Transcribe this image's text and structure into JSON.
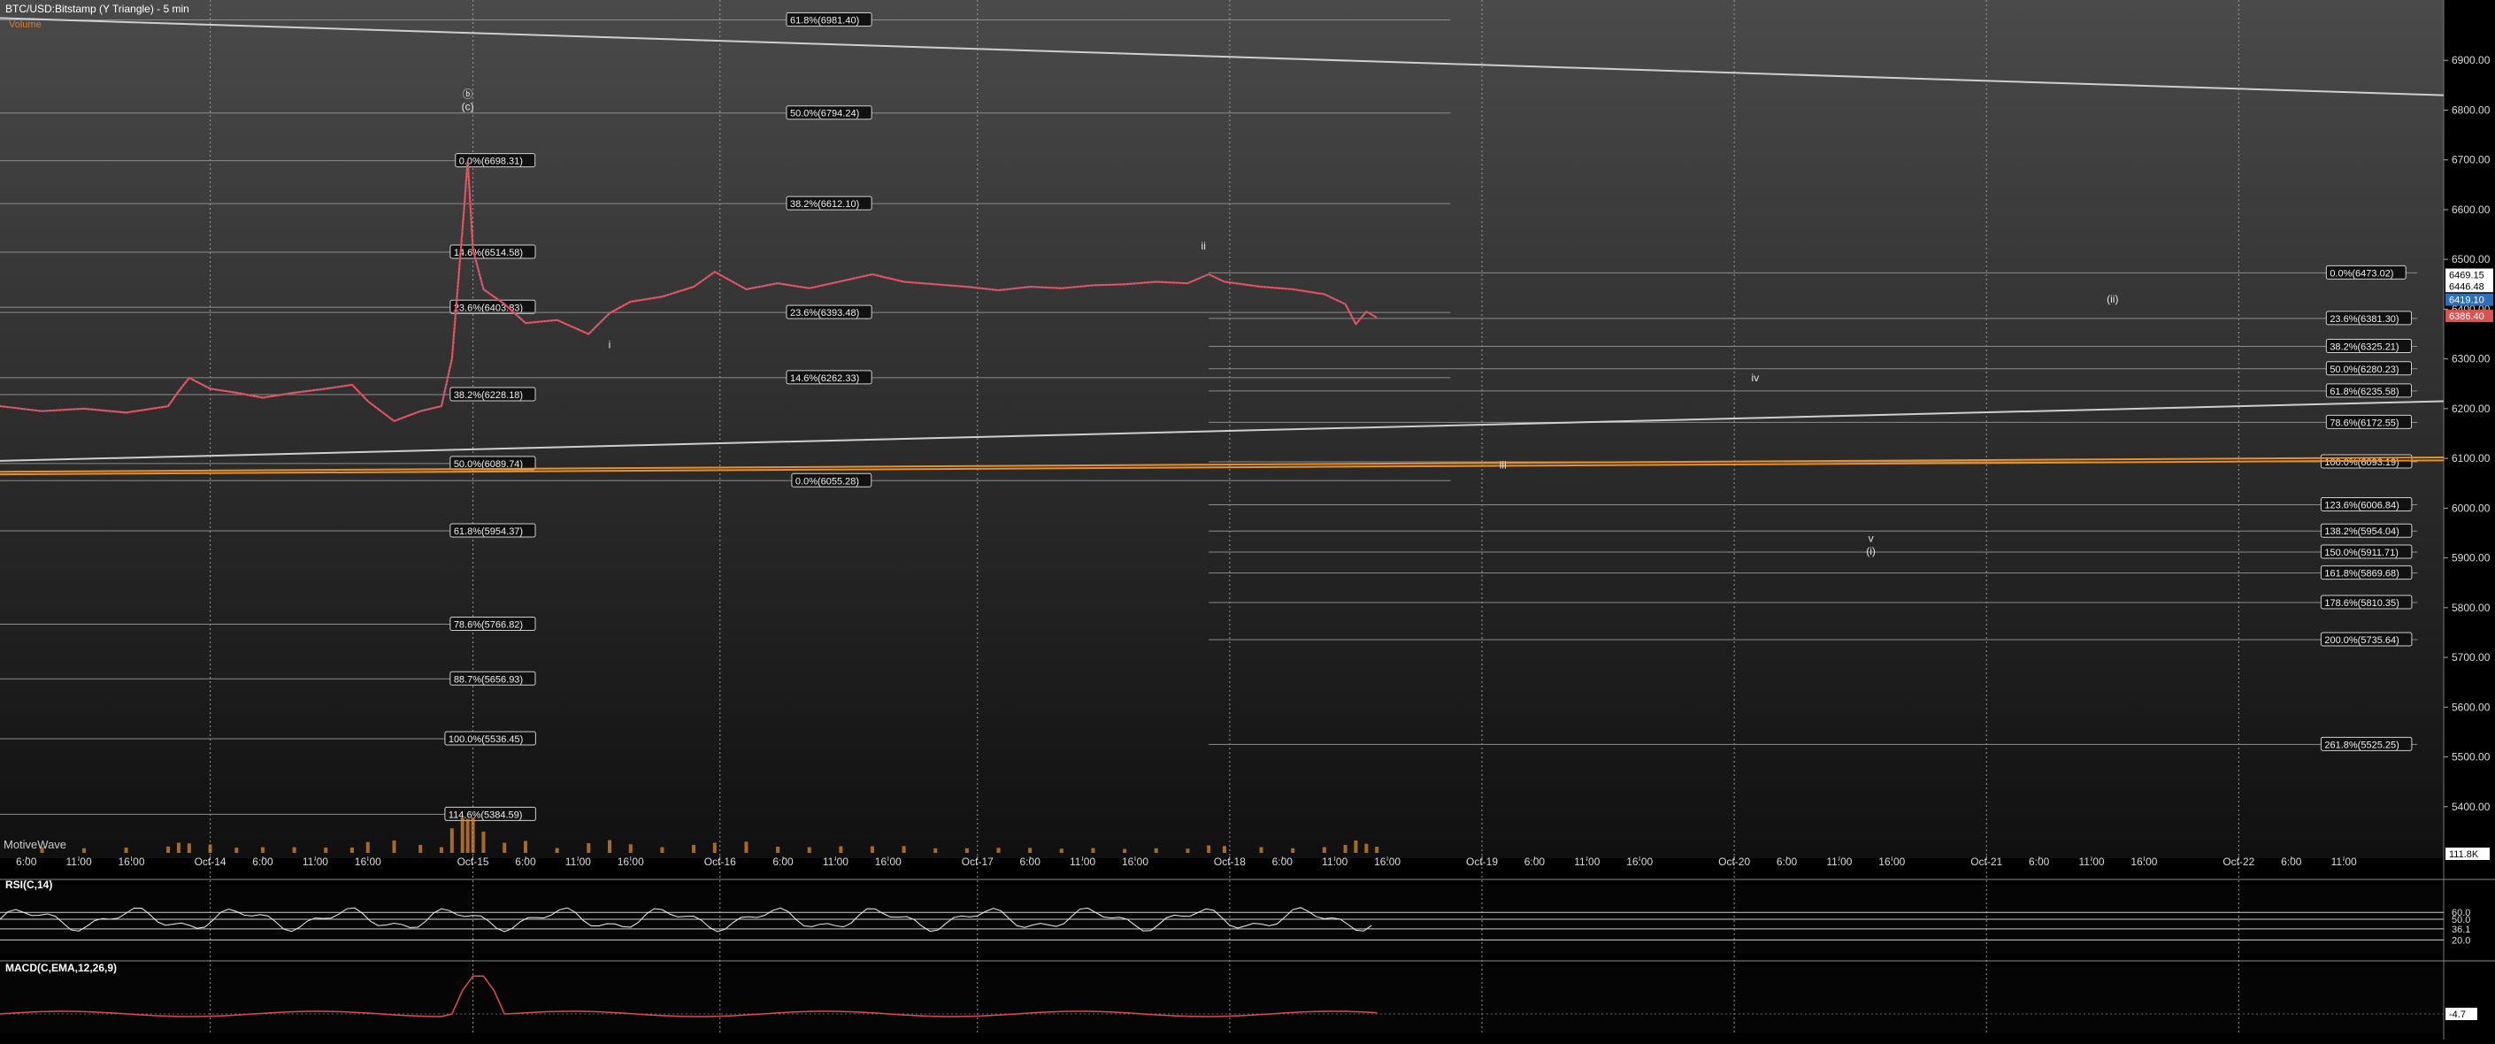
{
  "header": {
    "title": "BTC/USD:Bitstamp (Y Triangle) - 5 min",
    "subtitle": "Volume",
    "watermark": "MotiveWave"
  },
  "chart_data": {
    "type": "line",
    "price_axis": {
      "min": 5300,
      "max": 7000,
      "ticks": [
        6900,
        6800,
        6700,
        6600,
        6500,
        6400,
        6300,
        6200,
        6100,
        6000,
        5900,
        5800,
        5700,
        5600,
        5500,
        5400
      ]
    },
    "time_labels": [
      {
        "t": 0.5,
        "label": "6:00"
      },
      {
        "t": 1.5,
        "label": "11:00"
      },
      {
        "t": 2.5,
        "label": "16:00"
      },
      {
        "t": 4.0,
        "label": "Oct-14"
      },
      {
        "t": 5.0,
        "label": "6:00"
      },
      {
        "t": 6.0,
        "label": "11:00"
      },
      {
        "t": 7.0,
        "label": "16:00"
      },
      {
        "t": 9.0,
        "label": "Oct-15"
      },
      {
        "t": 10.0,
        "label": "6:00"
      },
      {
        "t": 11.0,
        "label": "11:00"
      },
      {
        "t": 12.0,
        "label": "16:00"
      },
      {
        "t": 13.7,
        "label": "Oct-16"
      },
      {
        "t": 14.9,
        "label": "6:00"
      },
      {
        "t": 15.9,
        "label": "11:00"
      },
      {
        "t": 16.9,
        "label": "16:00"
      },
      {
        "t": 18.6,
        "label": "Oct-17"
      },
      {
        "t": 19.6,
        "label": "6:00"
      },
      {
        "t": 20.6,
        "label": "11:00"
      },
      {
        "t": 21.6,
        "label": "16:00"
      },
      {
        "t": 23.4,
        "label": "Oct-18"
      },
      {
        "t": 24.4,
        "label": "6:00"
      },
      {
        "t": 25.4,
        "label": "11:00"
      },
      {
        "t": 26.4,
        "label": "16:00"
      },
      {
        "t": 28.2,
        "label": "Oct-19"
      },
      {
        "t": 29.2,
        "label": "6:00"
      },
      {
        "t": 30.2,
        "label": "11:00"
      },
      {
        "t": 31.2,
        "label": "16:00"
      },
      {
        "t": 33.0,
        "label": "Oct-20"
      },
      {
        "t": 34.0,
        "label": "6:00"
      },
      {
        "t": 35.0,
        "label": "11:00"
      },
      {
        "t": 36.0,
        "label": "16:00"
      },
      {
        "t": 37.8,
        "label": "Oct-21"
      },
      {
        "t": 38.8,
        "label": "6:00"
      },
      {
        "t": 39.8,
        "label": "11:00"
      },
      {
        "t": 40.8,
        "label": "16:00"
      },
      {
        "t": 42.6,
        "label": "Oct-22"
      },
      {
        "t": 43.6,
        "label": "6:00"
      },
      {
        "t": 44.6,
        "label": "11:00"
      }
    ],
    "price_series": [
      {
        "t": 0,
        "p": 6205
      },
      {
        "t": 0.8,
        "p": 6195
      },
      {
        "t": 1.6,
        "p": 6200
      },
      {
        "t": 2.4,
        "p": 6192
      },
      {
        "t": 3.2,
        "p": 6205
      },
      {
        "t": 3.4,
        "p": 6235
      },
      {
        "t": 3.6,
        "p": 6262
      },
      {
        "t": 4.0,
        "p": 6240
      },
      {
        "t": 4.5,
        "p": 6232
      },
      {
        "t": 5.0,
        "p": 6222
      },
      {
        "t": 5.6,
        "p": 6232
      },
      {
        "t": 6.2,
        "p": 6240
      },
      {
        "t": 6.7,
        "p": 6248
      },
      {
        "t": 7.0,
        "p": 6215
      },
      {
        "t": 7.5,
        "p": 6175
      },
      {
        "t": 8.0,
        "p": 6195
      },
      {
        "t": 8.4,
        "p": 6205
      },
      {
        "t": 8.6,
        "p": 6300
      },
      {
        "t": 8.8,
        "p": 6560
      },
      {
        "t": 8.9,
        "p": 6698
      },
      {
        "t": 9.0,
        "p": 6520
      },
      {
        "t": 9.2,
        "p": 6440
      },
      {
        "t": 9.6,
        "p": 6410
      },
      {
        "t": 10.0,
        "p": 6372
      },
      {
        "t": 10.6,
        "p": 6378
      },
      {
        "t": 11.2,
        "p": 6350
      },
      {
        "t": 11.6,
        "p": 6392
      },
      {
        "t": 12.0,
        "p": 6415
      },
      {
        "t": 12.6,
        "p": 6425
      },
      {
        "t": 13.2,
        "p": 6445
      },
      {
        "t": 13.6,
        "p": 6475
      },
      {
        "t": 14.2,
        "p": 6440
      },
      {
        "t": 14.8,
        "p": 6452
      },
      {
        "t": 15.4,
        "p": 6442
      },
      {
        "t": 16.0,
        "p": 6456
      },
      {
        "t": 16.6,
        "p": 6470
      },
      {
        "t": 17.2,
        "p": 6455
      },
      {
        "t": 17.8,
        "p": 6450
      },
      {
        "t": 18.4,
        "p": 6445
      },
      {
        "t": 19.0,
        "p": 6438
      },
      {
        "t": 19.6,
        "p": 6445
      },
      {
        "t": 20.2,
        "p": 6442
      },
      {
        "t": 20.8,
        "p": 6448
      },
      {
        "t": 21.4,
        "p": 6450
      },
      {
        "t": 22.0,
        "p": 6455
      },
      {
        "t": 22.6,
        "p": 6452
      },
      {
        "t": 23.0,
        "p": 6470
      },
      {
        "t": 23.3,
        "p": 6455
      },
      {
        "t": 24.0,
        "p": 6445
      },
      {
        "t": 24.6,
        "p": 6440
      },
      {
        "t": 25.2,
        "p": 6430
      },
      {
        "t": 25.6,
        "p": 6410
      },
      {
        "t": 25.8,
        "p": 6370
      },
      {
        "t": 26.0,
        "p": 6395
      },
      {
        "t": 26.2,
        "p": 6383
      }
    ],
    "fib_levels": [
      {
        "price": 6981.4,
        "label": "61.8%(6981.40)",
        "t0": 0,
        "t1": 27.6,
        "tl": 15.0
      },
      {
        "price": 6794.24,
        "label": "50.0%(6794.24)",
        "t0": 0,
        "t1": 27.6,
        "tl": 15.0
      },
      {
        "price": 6698.31,
        "label": "0.0%(6698.31)",
        "t0": 0,
        "t1": 9.6,
        "tl": 8.7
      },
      {
        "price": 6612.1,
        "label": "38.2%(6612.10)",
        "t0": 0,
        "t1": 27.6,
        "tl": 15.0
      },
      {
        "price": 6514.58,
        "label": "14.6%(6514.58)",
        "t0": 0,
        "t1": 9.6,
        "tl": 8.6
      },
      {
        "price": 6403.83,
        "label": "23.6%(6403.83)",
        "t0": 0,
        "t1": 9.6,
        "tl": 8.6
      },
      {
        "price": 6393.48,
        "label": "23.6%(6393.48)",
        "t0": 0,
        "t1": 27.6,
        "tl": 15.0
      },
      {
        "price": 6262.33,
        "label": "14.6%(6262.33)",
        "t0": 0,
        "t1": 27.6,
        "tl": 15.0
      },
      {
        "price": 6228.18,
        "label": "38.2%(6228.18)",
        "t0": 0,
        "t1": 9.6,
        "tl": 8.6
      },
      {
        "price": 6089.74,
        "label": "50.0%(6089.74)",
        "t0": 0,
        "t1": 9.6,
        "tl": 8.6
      },
      {
        "price": 6055.28,
        "label": "0.0%(6055.28)",
        "t0": 0,
        "t1": 27.6,
        "tl": 15.1
      },
      {
        "price": 5954.37,
        "label": "61.8%(5954.37)",
        "t0": 0,
        "t1": 9.6,
        "tl": 8.6
      },
      {
        "price": 5766.82,
        "label": "78.6%(5766.82)",
        "t0": 0,
        "t1": 9.6,
        "tl": 8.6
      },
      {
        "price": 5656.93,
        "label": "88.7%(5656.93)",
        "t0": 0,
        "t1": 9.6,
        "tl": 8.6
      },
      {
        "price": 5536.45,
        "label": "100.0%(5536.45)",
        "t0": 0,
        "t1": 9.6,
        "tl": 8.5
      },
      {
        "price": 5384.59,
        "label": "114.6%(5384.59)",
        "t0": 0,
        "t1": 9.6,
        "tl": 8.5
      },
      {
        "price": 6473.02,
        "label": "0.0%(6473.02)",
        "t0": 23.0,
        "t1": 46.0,
        "tl": 44.3
      },
      {
        "price": 6381.3,
        "label": "23.6%(6381.30)",
        "t0": 23.0,
        "t1": 46.0,
        "tl": 44.3
      },
      {
        "price": 6325.21,
        "label": "38.2%(6325.21)",
        "t0": 23.0,
        "t1": 46.0,
        "tl": 44.3
      },
      {
        "price": 6280.23,
        "label": "50.0%(6280.23)",
        "t0": 23.0,
        "t1": 46.0,
        "tl": 44.3
      },
      {
        "price": 6235.58,
        "label": "61.8%(6235.58)",
        "t0": 23.0,
        "t1": 46.0,
        "tl": 44.3
      },
      {
        "price": 6172.55,
        "label": "78.6%(6172.55)",
        "t0": 23.0,
        "t1": 46.0,
        "tl": 44.3
      },
      {
        "price": 6093.19,
        "label": "100.0%(6093.19)",
        "t0": 23.0,
        "t1": 46.0,
        "tl": 44.2
      },
      {
        "price": 6006.84,
        "label": "123.6%(6006.84)",
        "t0": 23.0,
        "t1": 46.0,
        "tl": 44.2
      },
      {
        "price": 5954.04,
        "label": "138.2%(5954.04)",
        "t0": 23.0,
        "t1": 46.0,
        "tl": 44.2
      },
      {
        "price": 5911.71,
        "label": "150.0%(5911.71)",
        "t0": 23.0,
        "t1": 46.0,
        "tl": 44.2
      },
      {
        "price": 5869.68,
        "label": "161.8%(5869.68)",
        "t0": 23.0,
        "t1": 46.0,
        "tl": 44.2
      },
      {
        "price": 5810.35,
        "label": "178.6%(5810.35)",
        "t0": 23.0,
        "t1": 46.0,
        "tl": 44.2
      },
      {
        "price": 5735.64,
        "label": "200.0%(5735.64)",
        "t0": 23.0,
        "t1": 46.0,
        "tl": 44.2
      },
      {
        "price": 5525.25,
        "label": "261.8%(5525.25)",
        "t0": 23.0,
        "t1": 46.0,
        "tl": 44.2
      }
    ],
    "trend_lines": [
      {
        "name": "upper",
        "t0": 0,
        "p0": 6985,
        "t1": 46.5,
        "p1": 6830,
        "color": "#cfcfcf"
      },
      {
        "name": "lower",
        "t0": 0,
        "p0": 6095,
        "t1": 46.5,
        "p1": 6215,
        "color": "#cfcfcf"
      },
      {
        "name": "orange-upper",
        "t0": 0,
        "p0": 6073,
        "t1": 46.5,
        "p1": 6102,
        "color": "#e8902c"
      },
      {
        "name": "orange-lower",
        "t0": 0,
        "p0": 6068,
        "t1": 46.5,
        "p1": 6096,
        "color": "#e8902c"
      }
    ],
    "wave_labels": [
      {
        "t": 8.9,
        "price": 6825,
        "label": "ⓑ"
      },
      {
        "t": 8.9,
        "price": 6800,
        "label": "(c)"
      },
      {
        "t": 11.6,
        "price": 6322,
        "label": "i"
      },
      {
        "t": 22.9,
        "price": 6520,
        "label": "ii"
      },
      {
        "t": 28.6,
        "price": 6080,
        "label": "iii"
      },
      {
        "t": 33.4,
        "price": 6255,
        "label": "iv"
      },
      {
        "t": 35.6,
        "price": 5932,
        "label": "v"
      },
      {
        "t": 35.6,
        "price": 5906,
        "label": "(i)"
      },
      {
        "t": 40.2,
        "price": 6413,
        "label": "(ii)"
      }
    ],
    "price_badges": [
      {
        "price": 6469.15,
        "label": "6469.15",
        "color": "#ffffff"
      },
      {
        "price": 6446.48,
        "label": "6446.48",
        "color": "#ffffff"
      },
      {
        "price": 6419.1,
        "label": "6419.10",
        "color": "#2f6fb8"
      },
      {
        "price": 6386.4,
        "label": "6386.40",
        "color": "#d9534f"
      }
    ],
    "volume_badge": "111.8K",
    "rsi": {
      "label": "RSI(C,14)",
      "ticks": [
        "60.0",
        "50.0",
        "36.1",
        "20.0"
      ],
      "levels": [
        60,
        50,
        36.1,
        20
      ]
    },
    "macd": {
      "label": "MACD(C,EMA,12,26,9)",
      "last_value": "-4.7"
    }
  }
}
